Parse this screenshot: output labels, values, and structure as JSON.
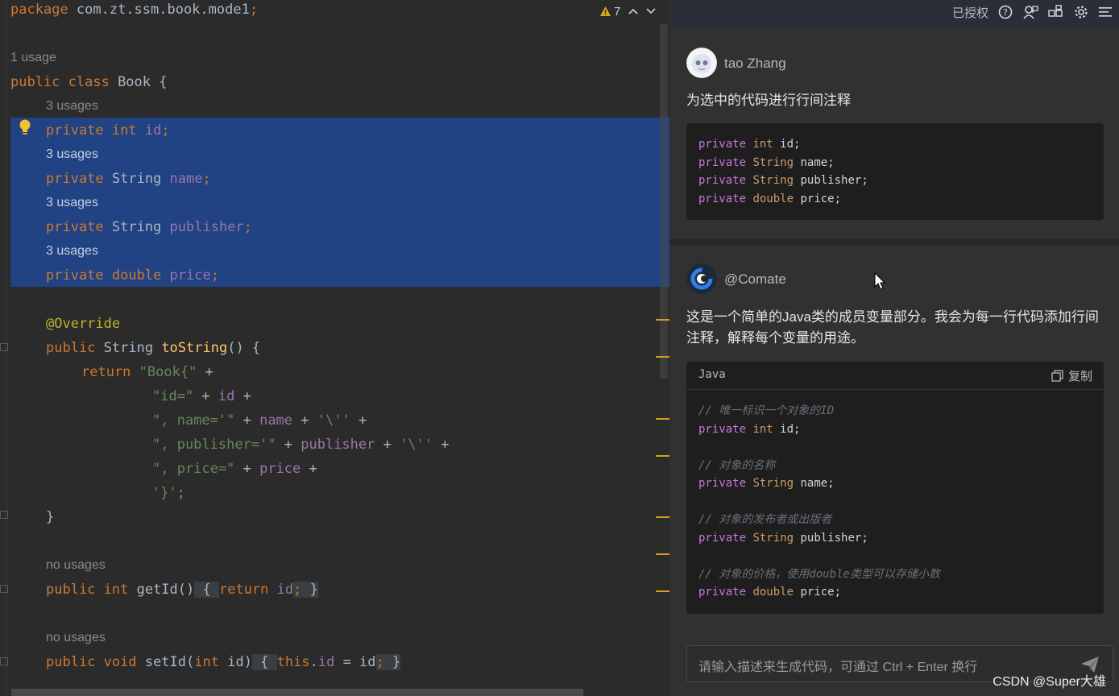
{
  "editor": {
    "warning_count": "7",
    "lines": {
      "package_kw": "package",
      "package_name": " com.zt.ssm.book.mode1",
      "package_semi": ";",
      "usage_class": "1 usage",
      "class_decl_kw": "public class",
      "class_decl_name": " Book {",
      "usage_id": "3 usages",
      "field_id_kw": "private int",
      "field_id_name": " id",
      "field_id_semi": ";",
      "usage_name": "3 usages",
      "field_name_kw": "private",
      "field_name_type": " String ",
      "field_name_name": "name",
      "field_name_semi": ";",
      "usage_publisher": "3 usages",
      "field_pub_kw": "private",
      "field_pub_type": " String ",
      "field_pub_name": "publisher",
      "field_pub_semi": ";",
      "usage_price": "3 usages",
      "field_price_kw": "private double",
      "field_price_name": " price",
      "field_price_semi": ";",
      "override": "@Override",
      "tostring_kw": "public",
      "tostring_type": " String ",
      "tostring_name": "toString",
      "tostring_rest": "() {",
      "return_kw": "return",
      "return_str": " \"Book{\"",
      "return_plus": " +",
      "l_id_str": "\"id=\"",
      "l_id_plus": " + ",
      "l_id_fld": "id",
      "l_id_end": " +",
      "l_name_str": "\", name='\"",
      "l_name_plus": " + ",
      "l_name_fld": "name",
      "l_name_mid": " + ",
      "l_name_chr": "'\\''",
      "l_name_end": " +",
      "l_pub_str": "\", publisher='\"",
      "l_pub_plus": " + ",
      "l_pub_fld": "publisher",
      "l_pub_mid": " + ",
      "l_pub_chr": "'\\''",
      "l_pub_end": " +",
      "l_price_str": "\", price=\"",
      "l_price_plus": " + ",
      "l_price_fld": "price",
      "l_price_end": " +",
      "l_close_str": "'}'",
      "l_close_semi": ";",
      "close_brace": "}",
      "usage_getid": "no usages",
      "getid_kw": "public int",
      "getid_name": " getId",
      "getid_paren": "()",
      "getid_open": " { ",
      "getid_ret": "return",
      "getid_fld": " id",
      "getid_semi": ";",
      "getid_close": " }",
      "usage_setid": "no usages",
      "setid_kw": "public void",
      "setid_name": " setId",
      "setid_p1": "(",
      "setid_ptype": "int",
      "setid_pname": " id)",
      "setid_open": " { ",
      "setid_this": "this",
      "setid_dot": ".",
      "setid_fld": "id",
      "setid_eq": " = id",
      "setid_semi": ";",
      "setid_close": " }"
    }
  },
  "panel": {
    "header_auth": "已授权",
    "user": {
      "name": "tao Zhang",
      "message": "为选中的代码进行行间注释",
      "code": [
        {
          "kw": "private",
          "type": "int",
          "name": " id;"
        },
        {
          "kw": "private",
          "type": "String",
          "name": " name;"
        },
        {
          "kw": "private",
          "type": "String",
          "name": " publisher;"
        },
        {
          "kw": "private",
          "type": "double",
          "name": " price;"
        }
      ]
    },
    "bot": {
      "name": "@Comate",
      "message": "这是一个简单的Java类的成员变量部分。我会为每一行代码添加行间注释，解释每个变量的用途。",
      "code_lang": "Java",
      "copy_label": "复制",
      "code": [
        {
          "comment": "// 唯一标识一个对象的ID",
          "kw": "private",
          "type": "int",
          "name": " id;"
        },
        {
          "comment": "// 对象的名称",
          "kw": "private",
          "type": "String",
          "name": " name;"
        },
        {
          "comment": "// 对象的发布者或出版者",
          "kw": "private",
          "type": "String",
          "name": " publisher;"
        },
        {
          "comment": "// 对象的价格，使用double类型可以存储小数",
          "kw": "private",
          "type": "double",
          "name": " price;"
        }
      ]
    },
    "input_placeholder": "请输入描述来生成代码，可通过 Ctrl + Enter 换行"
  },
  "watermark": "CSDN @Super大雄"
}
